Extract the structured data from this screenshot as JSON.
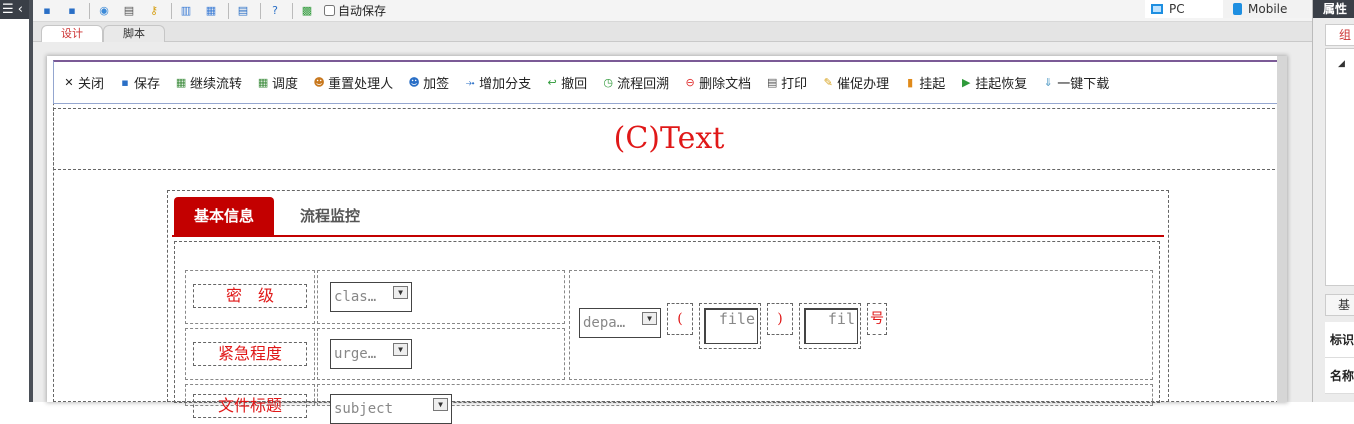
{
  "left_panel": {
    "toggle_glyph": "☰ ‹"
  },
  "toolbar": {
    "icons": [
      {
        "name": "new",
        "color": "#2a6fc6",
        "glyph": "▪"
      },
      {
        "name": "save",
        "color": "#2a6fc6",
        "glyph": "▪"
      },
      {
        "name": "preview",
        "color": "#3c8ad8",
        "glyph": "◉"
      },
      {
        "name": "print",
        "color": "#555555",
        "glyph": "▤"
      },
      {
        "name": "key",
        "color": "#d6a11a",
        "glyph": "⚷"
      },
      {
        "name": "import",
        "color": "#3a7bd5",
        "glyph": "▥"
      },
      {
        "name": "export",
        "color": "#3a7bd5",
        "glyph": "▦"
      },
      {
        "name": "list",
        "color": "#2a6fc6",
        "glyph": "▤"
      },
      {
        "name": "help",
        "color": "#2a6fc6",
        "glyph": "?"
      },
      {
        "name": "layers",
        "color": "#2f9a3a",
        "glyph": "▩"
      }
    ],
    "autosave_label": "自动保存"
  },
  "device_switch": {
    "pc_label": "PC",
    "mobile_label": "Mobile"
  },
  "doc_tabs": {
    "design": "设计",
    "script": "脚本"
  },
  "actions": [
    {
      "icon": "close-icon",
      "glyph": "✕",
      "color": "#222222",
      "label": "关闭"
    },
    {
      "icon": "save-icon",
      "glyph": "▪",
      "color": "#2a6fc6",
      "label": "保存"
    },
    {
      "icon": "continue-icon",
      "glyph": "▦",
      "color": "#3a8a3a",
      "label": "继续流转"
    },
    {
      "icon": "dispatch-icon",
      "glyph": "▦",
      "color": "#3a8a3a",
      "label": "调度"
    },
    {
      "icon": "reassign-icon",
      "glyph": "☻",
      "color": "#c8781e",
      "label": "重置处理人"
    },
    {
      "icon": "countersign-icon",
      "glyph": "☻",
      "color": "#2a6fc6",
      "label": "加签"
    },
    {
      "icon": "branch-icon",
      "glyph": "⤞",
      "color": "#2a6fc6",
      "label": "增加分支"
    },
    {
      "icon": "withdraw-icon",
      "glyph": "↩",
      "color": "#2f9a3a",
      "label": "撤回"
    },
    {
      "icon": "trace-back-icon",
      "glyph": "◷",
      "color": "#2f9a3a",
      "label": "流程回溯"
    },
    {
      "icon": "delete-icon",
      "glyph": "⊖",
      "color": "#e03030",
      "label": "删除文档"
    },
    {
      "icon": "print-icon",
      "glyph": "▤",
      "color": "#555555",
      "label": "打印"
    },
    {
      "icon": "urge-icon",
      "glyph": "✎",
      "color": "#d6a11a",
      "label": "催促办理"
    },
    {
      "icon": "suspend-icon",
      "glyph": "▮",
      "color": "#e08a1a",
      "label": "挂起"
    },
    {
      "icon": "resume-icon",
      "glyph": "▶",
      "color": "#2f9a3a",
      "label": "挂起恢复"
    },
    {
      "icon": "download-icon",
      "glyph": "⇓",
      "color": "#5aa0c8",
      "label": "一键下载"
    }
  ],
  "form": {
    "title": "(C)Text",
    "tabs": {
      "active": "基本信息",
      "inactive": "流程监控"
    },
    "fields": {
      "classification": {
        "label": "密　级",
        "value": "clas…"
      },
      "urgency": {
        "label": "紧急程度",
        "value": "urge…"
      },
      "subject": {
        "label": "文件标题",
        "value": "subject"
      },
      "department": {
        "value": "depa…"
      },
      "open_paren": "(",
      "close_paren": ")",
      "file_year": "file",
      "file_no": "fil",
      "number_suffix": "号"
    }
  },
  "properties": {
    "header": "属性",
    "tab_group": "组",
    "tab_basic": "基",
    "rows": [
      "标识",
      "名称"
    ]
  }
}
